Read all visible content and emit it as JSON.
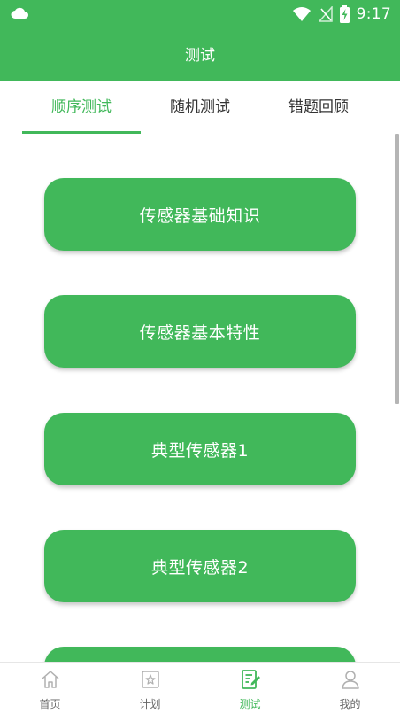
{
  "status_bar": {
    "time": "9:17"
  },
  "header": {
    "title": "测试"
  },
  "tabs": [
    {
      "label": "顺序测试",
      "active": true
    },
    {
      "label": "随机测试",
      "active": false
    },
    {
      "label": "错题回顾",
      "active": false
    }
  ],
  "tests": [
    {
      "label": "传感器基础知识"
    },
    {
      "label": "传感器基本特性"
    },
    {
      "label": "典型传感器1"
    },
    {
      "label": "典型传感器2"
    },
    {
      "label": ""
    }
  ],
  "bottom_nav": [
    {
      "label": "首页",
      "icon": "home-icon",
      "active": false
    },
    {
      "label": "计划",
      "icon": "plan-icon",
      "active": false
    },
    {
      "label": "测试",
      "icon": "test-icon",
      "active": true
    },
    {
      "label": "我的",
      "icon": "profile-icon",
      "active": false
    }
  ],
  "colors": {
    "accent": "#41b85a",
    "tab_text": "#333333",
    "nav_text": "#666666",
    "nav_icon": "#b0b0b0"
  }
}
